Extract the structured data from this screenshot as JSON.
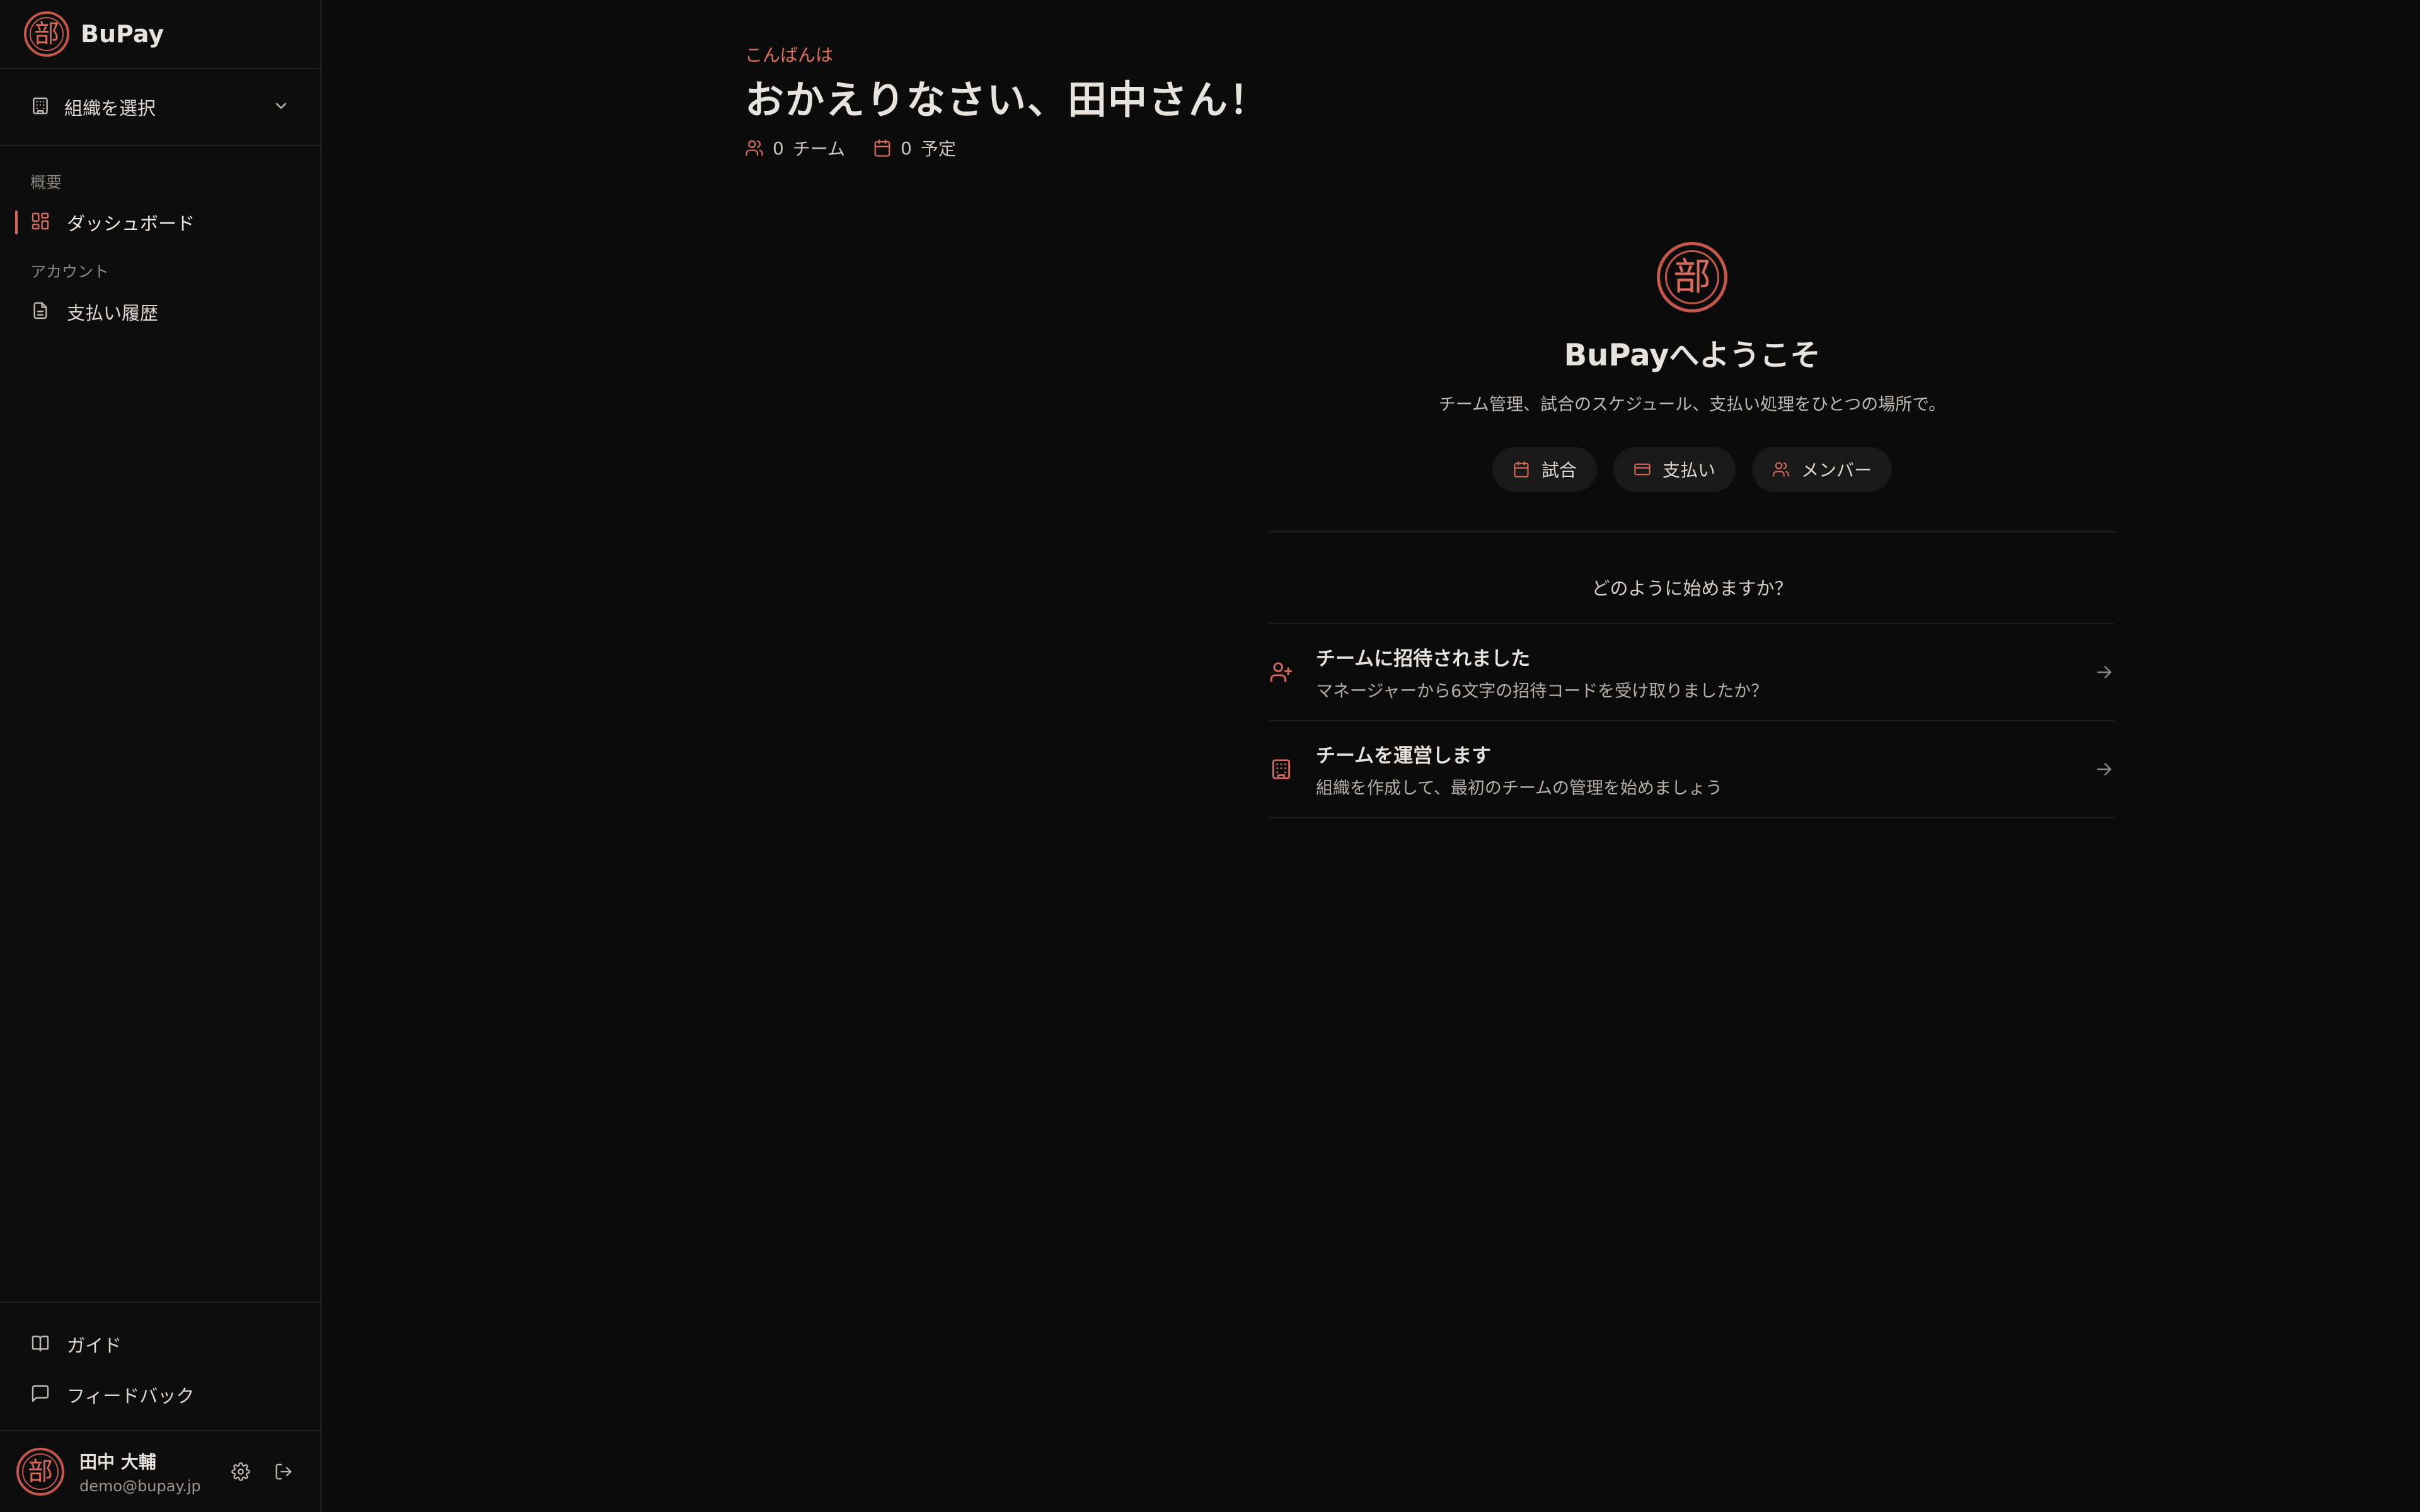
{
  "brand": {
    "name": "BuPay",
    "logo_char": "部"
  },
  "colors": {
    "accent": "#d96a5a",
    "background": "#0b0b0b",
    "sidebar": "#0d0d0d"
  },
  "sidebar": {
    "org_select": {
      "label": "組織を選択",
      "icon": "building-icon"
    },
    "sections": [
      {
        "heading": "概要",
        "items": [
          {
            "label": "ダッシュボード",
            "icon": "dashboard-icon",
            "active": true
          }
        ]
      },
      {
        "heading": "アカウント",
        "items": [
          {
            "label": "支払い履歴",
            "icon": "document-icon",
            "active": false
          }
        ]
      }
    ],
    "bottom_links": [
      {
        "label": "ガイド",
        "icon": "book-icon"
      },
      {
        "label": "フィードバック",
        "icon": "message-icon"
      }
    ],
    "user": {
      "name": "田中 大輔",
      "email": "demo@bupay.jp"
    }
  },
  "header": {
    "greeting": "こんばんは",
    "title": "おかえりなさい、田中さん！",
    "stats": [
      {
        "value": "0",
        "label": "チーム",
        "icon": "users-icon"
      },
      {
        "value": "0",
        "label": "予定",
        "icon": "calendar-icon"
      }
    ]
  },
  "welcome": {
    "title": "BuPayへようこそ",
    "subtitle": "チーム管理、試合のスケジュール、支払い処理をひとつの場所で。",
    "pills": [
      {
        "label": "試合",
        "icon": "calendar-icon"
      },
      {
        "label": "支払い",
        "icon": "credit-card-icon"
      },
      {
        "label": "メンバー",
        "icon": "users-icon"
      }
    ],
    "question": "どのように始めますか？",
    "options": [
      {
        "title": "チームに招待されました",
        "description": "マネージャーから6文字の招待コードを受け取りましたか？",
        "icon": "user-plus-icon"
      },
      {
        "title": "チームを運営します",
        "description": "組織を作成して、最初のチームの管理を始めましょう",
        "icon": "building-icon"
      }
    ]
  }
}
